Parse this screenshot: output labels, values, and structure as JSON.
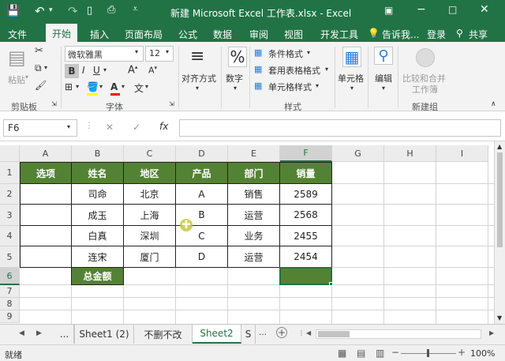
{
  "title": "新建 Microsoft Excel 工作表.xlsx - Excel",
  "tabs": [
    "文件",
    "开始",
    "插入",
    "页面布局",
    "公式",
    "数据",
    "审阅",
    "视图",
    "开发工具"
  ],
  "tell_me": "告诉我...",
  "login": "登录",
  "share": "共享",
  "ribbon": {
    "paste": "粘贴",
    "clipboard": "剪贴板",
    "font_name": "微软雅黑",
    "font_size": "12",
    "font_group": "字体",
    "alignment": "对齐方式",
    "number": "数字",
    "cond_format": "条件格式",
    "table_format": "套用表格格式",
    "cell_style": "单元格样式",
    "style_group": "样式",
    "cells": "单元格",
    "edit": "编辑",
    "compare1": "比较和合并",
    "compare2": "工作簿",
    "new_group": "新建组"
  },
  "name_box": "F6",
  "fx": "fx",
  "columns": [
    "A",
    "B",
    "C",
    "D",
    "E",
    "F",
    "G",
    "H",
    "I"
  ],
  "rows": [
    "1",
    "2",
    "3",
    "4",
    "5",
    "6",
    "7",
    "8",
    "9"
  ],
  "headers": [
    "选项",
    "姓名",
    "地区",
    "产品",
    "部门",
    "销量"
  ],
  "data": [
    [
      "",
      "司命",
      "北京",
      "A",
      "销售",
      "2589"
    ],
    [
      "",
      "成玉",
      "上海",
      "B",
      "运营",
      "2568"
    ],
    [
      "",
      "白真",
      "深圳",
      "C",
      "业务",
      "2455"
    ],
    [
      "",
      "连宋",
      "厦门",
      "D",
      "运营",
      "2454"
    ]
  ],
  "total_label": "总金额",
  "sheets": [
    "...",
    "Sheet1 (2)",
    "不删不改",
    "Sheet2",
    "S"
  ],
  "status": "就绪",
  "zoom": "100%",
  "colors": {
    "excel_green": "#217346",
    "header_fill": "#548235"
  }
}
